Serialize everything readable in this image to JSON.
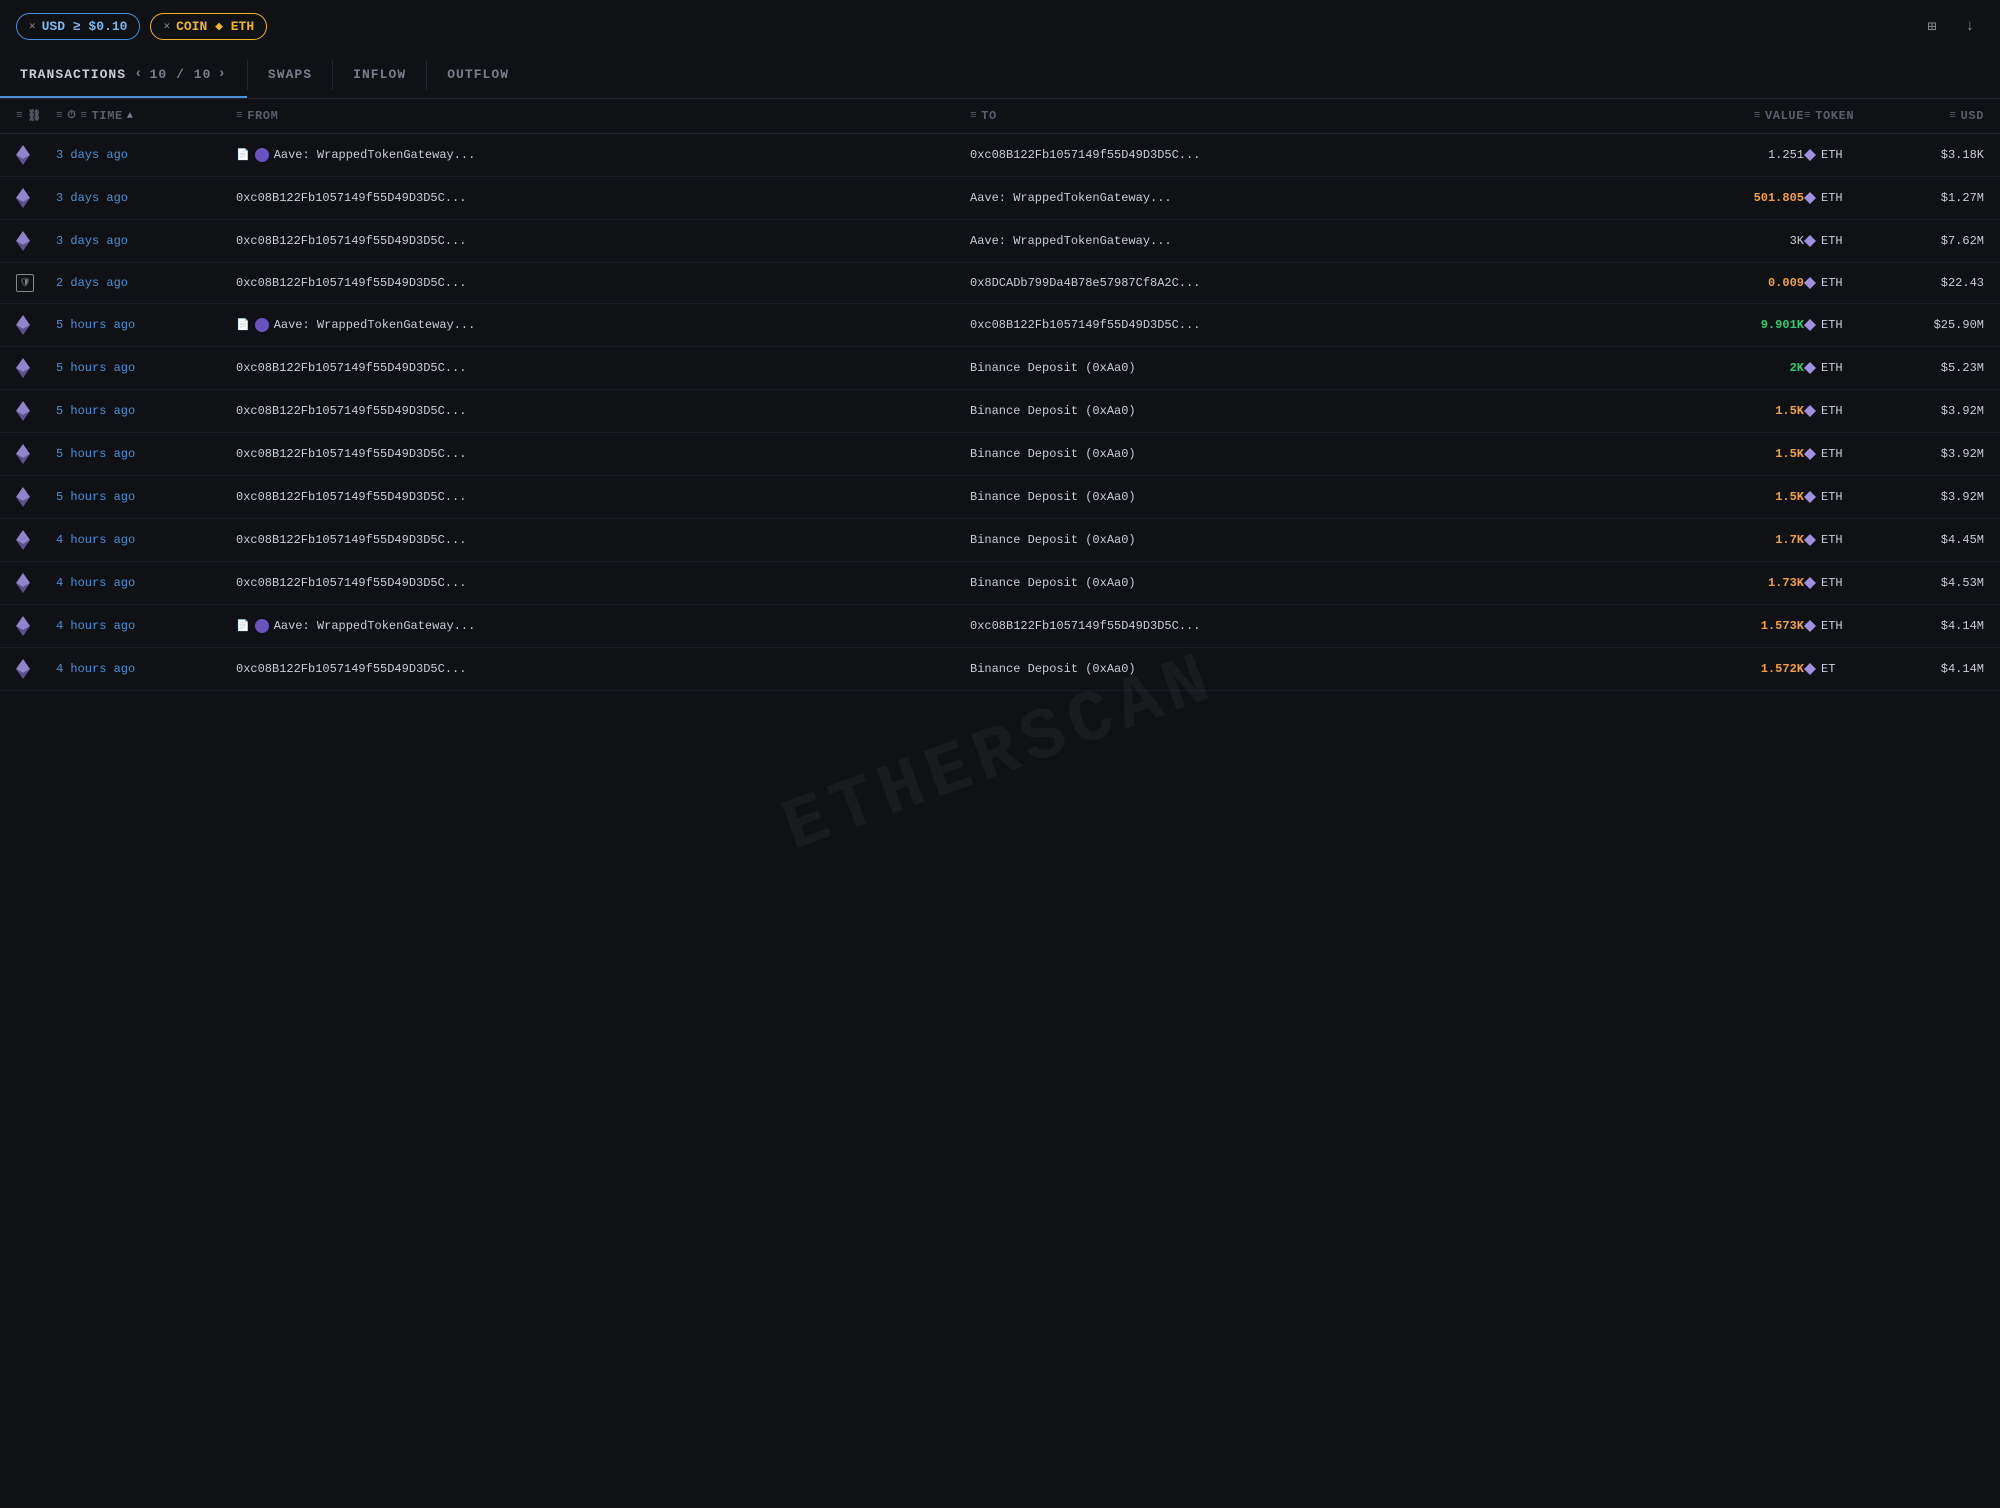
{
  "filters": {
    "usd_label": "USD ≥ $0.10",
    "coin_label": "COIN ◆ ETH"
  },
  "tabs": {
    "transactions": "TRANSACTIONS",
    "pagination": "10 / 10",
    "swaps": "SWAPS",
    "inflow": "INFLOW",
    "outflow": "OUTFLOW"
  },
  "columns": {
    "time": "TIME",
    "from": "FROM",
    "to": "TO",
    "value": "VALUE",
    "token": "TOKEN",
    "usd": "USD"
  },
  "rows": [
    {
      "time": "3 days ago",
      "from_named": "Aave: WrappedTokenGateway...",
      "from_addr": null,
      "to_addr": "0xc08B122Fb1057149f55D49D3D5C...",
      "to_named": null,
      "value": "1.251",
      "value_color": "normal",
      "token": "ETH",
      "usd": "$3.18K",
      "has_file_icon": true,
      "has_circle": true
    },
    {
      "time": "3 days ago",
      "from_named": null,
      "from_addr": "0xc08B122Fb1057149f55D49D3D5C...",
      "to_named": "Aave: WrappedTokenGateway...",
      "to_addr": null,
      "value": "501.805",
      "value_color": "orange",
      "token": "ETH",
      "usd": "$1.27M",
      "has_file_icon": true,
      "has_circle": true
    },
    {
      "time": "3 days ago",
      "from_named": null,
      "from_addr": "0xc08B122Fb1057149f55D49D3D5C...",
      "to_named": "Aave: WrappedTokenGateway...",
      "to_addr": null,
      "value": "3K",
      "value_color": "normal",
      "token": "ETH",
      "usd": "$7.62M",
      "has_file_icon": true,
      "has_circle": true
    },
    {
      "time": "2 days ago",
      "from_named": null,
      "from_addr": "0xc08B122Fb1057149f55D49D3D5C...",
      "to_named": null,
      "to_addr": "0x8DCADb799Da4B78e57987Cf8A2C...",
      "value": "0.009",
      "value_color": "orange",
      "token": "ETH",
      "usd": "$22.43",
      "has_file_icon": false,
      "has_circle": false,
      "special_icon": "shield"
    },
    {
      "time": "5 hours ago",
      "from_named": "Aave: WrappedTokenGateway...",
      "from_addr": null,
      "to_addr": "0xc08B122Fb1057149f55D49D3D5C...",
      "to_named": null,
      "value": "9.901K",
      "value_color": "green",
      "token": "ETH",
      "usd": "$25.90M",
      "has_file_icon": true,
      "has_circle": true
    },
    {
      "time": "5 hours ago",
      "from_named": null,
      "from_addr": "0xc08B122Fb1057149f55D49D3D5C...",
      "to_named": "Binance Deposit (0xAa0)",
      "to_addr": null,
      "value": "2K",
      "value_color": "green",
      "token": "ETH",
      "usd": "$5.23M",
      "has_file_icon": false,
      "has_circle": false
    },
    {
      "time": "5 hours ago",
      "from_named": null,
      "from_addr": "0xc08B122Fb1057149f55D49D3D5C...",
      "to_named": "Binance Deposit (0xAa0)",
      "to_addr": null,
      "value": "1.5K",
      "value_color": "orange",
      "token": "ETH",
      "usd": "$3.92M",
      "has_file_icon": false,
      "has_circle": false
    },
    {
      "time": "5 hours ago",
      "from_named": null,
      "from_addr": "0xc08B122Fb1057149f55D49D3D5C...",
      "to_named": "Binance Deposit (0xAa0)",
      "to_addr": null,
      "value": "1.5K",
      "value_color": "orange",
      "token": "ETH",
      "usd": "$3.92M",
      "has_file_icon": false,
      "has_circle": false
    },
    {
      "time": "5 hours ago",
      "from_named": null,
      "from_addr": "0xc08B122Fb1057149f55D49D3D5C...",
      "to_named": "Binance Deposit (0xAa0)",
      "to_addr": null,
      "value": "1.5K",
      "value_color": "orange",
      "token": "ETH",
      "usd": "$3.92M",
      "has_file_icon": false,
      "has_circle": false
    },
    {
      "time": "4 hours ago",
      "from_named": null,
      "from_addr": "0xc08B122Fb1057149f55D49D3D5C...",
      "to_named": "Binance Deposit (0xAa0)",
      "to_addr": null,
      "value": "1.7K",
      "value_color": "orange",
      "token": "ETH",
      "usd": "$4.45M",
      "has_file_icon": false,
      "has_circle": false
    },
    {
      "time": "4 hours ago",
      "from_named": null,
      "from_addr": "0xc08B122Fb1057149f55D49D3D5C...",
      "to_named": "Binance Deposit (0xAa0)",
      "to_addr": null,
      "value": "1.73K",
      "value_color": "orange",
      "token": "ETH",
      "usd": "$4.53M",
      "has_file_icon": false,
      "has_circle": false
    },
    {
      "time": "4 hours ago",
      "from_named": "Aave: WrappedTokenGateway...",
      "from_addr": null,
      "to_addr": "0xc08B122Fb1057149f55D49D3D5C...",
      "to_named": null,
      "value": "1.573K",
      "value_color": "orange",
      "token": "ETH",
      "usd": "$4.14M",
      "has_file_icon": true,
      "has_circle": true
    },
    {
      "time": "4 hours ago",
      "from_named": null,
      "from_addr": "0xc08B122Fb1057149f55D49D3D5C...",
      "to_named": "Binance Deposit (0xAa0)",
      "to_addr": null,
      "value": "1.572K",
      "value_color": "orange",
      "token": "ET",
      "usd": "$4.14M",
      "has_file_icon": false,
      "has_circle": false
    }
  ]
}
